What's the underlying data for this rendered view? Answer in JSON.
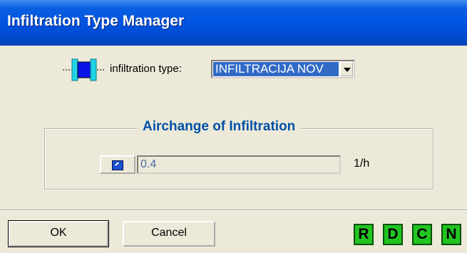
{
  "window": {
    "title": "Infiltration Type Manager"
  },
  "type_row": {
    "label": "infiltration type:",
    "selected": "INFILTRACIJA NOV",
    "icon": "infiltration-icon"
  },
  "group": {
    "title": "Airchange of Infiltration",
    "value": "0.4",
    "unit": "1/h",
    "pick_icon": "pick-arrow-icon"
  },
  "buttons": {
    "ok": "OK",
    "cancel": "Cancel"
  },
  "tools": [
    "R",
    "D",
    "C",
    "N"
  ],
  "colors": {
    "titlebar": "#0054e3",
    "selection": "#316ac5",
    "group_title": "#0050a8",
    "tool": "#22c422"
  }
}
